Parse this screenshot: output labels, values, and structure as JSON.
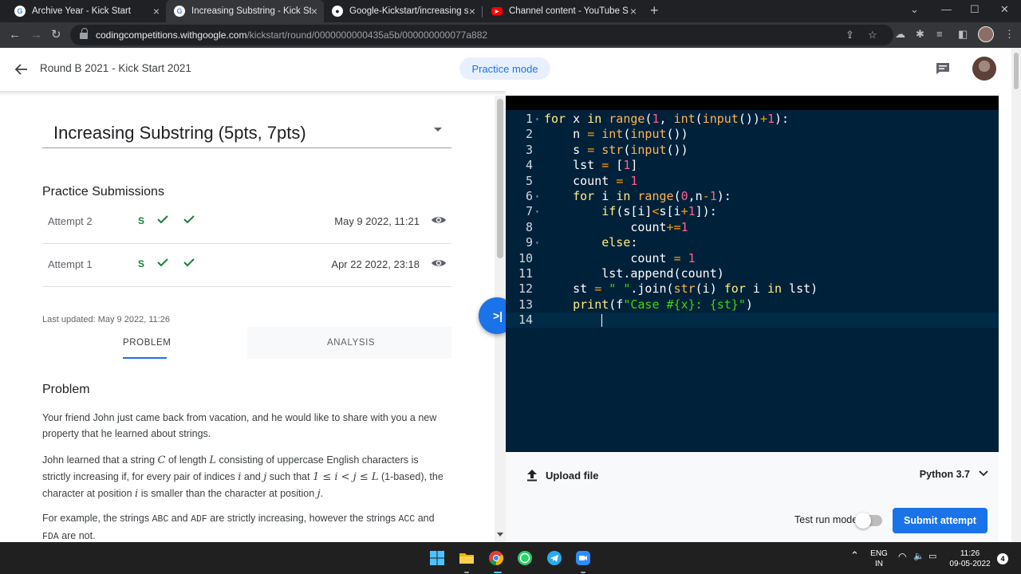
{
  "browser": {
    "tabs": [
      {
        "title": "Archive Year - Kick Start",
        "icon": "google-icon"
      },
      {
        "title": "Increasing Substring - Kick Start",
        "icon": "google-icon"
      },
      {
        "title": "Google-Kickstart/increasing subs",
        "icon": "github-icon"
      },
      {
        "title": "Channel content - YouTube Studi",
        "icon": "youtube-icon"
      }
    ],
    "url_host": "codingcompetitions.withgoogle.com",
    "url_path": "/kickstart/round/0000000000435a5b/000000000077a882"
  },
  "header": {
    "round_title": "Round B 2021 - Kick Start 2021",
    "practice_mode": "Practice mode"
  },
  "problem": {
    "title": "Increasing Substring (5pts, 7pts)",
    "submissions_title": "Practice Submissions",
    "attempts": [
      {
        "label": "Attempt 2",
        "status": "S",
        "date": "May 9 2022, 11:21"
      },
      {
        "label": "Attempt 1",
        "status": "S",
        "date": "Apr 22 2022, 23:18"
      }
    ],
    "last_updated": "Last updated: May 9 2022, 11:26",
    "tab_problem": "PROBLEM",
    "tab_analysis": "ANALYSIS",
    "heading": "Problem",
    "para1": "Your friend John just came back from vacation, and he would like to share with you a new property that he learned about strings.",
    "para2": {
      "t1": "John learned that a string ",
      "v1": "C",
      "t2": " of length ",
      "v2": "L",
      "t3": " consisting of uppercase English characters is strictly increasing if, for every pair of indices ",
      "v3": "i",
      "t4": " and ",
      "v4": "j",
      "t5": " such that ",
      "v5": "1 ≤ i < j ≤ L",
      "t6": " (1-based), the character at position ",
      "v6": "i",
      "t7": " is smaller than the character at position ",
      "v7": "j",
      "t8": "."
    },
    "para3": {
      "t1": "For example, the strings ",
      "c1": "ABC",
      "t2": " and ",
      "c2": "ADF",
      "t3": " are strictly increasing, however the strings ",
      "c3": "ACC",
      "t4": " and ",
      "c4": "FDA",
      "t5": " are not."
    }
  },
  "editor": {
    "line_numbers": [
      "1",
      "2",
      "3",
      "4",
      "5",
      "6",
      "7",
      "8",
      "9",
      "10",
      "11",
      "12",
      "13",
      "14"
    ],
    "upload_label": "Upload file",
    "language": "Python 3.7",
    "test_run_label": "Test run mode",
    "submit_label": "Submit attempt"
  },
  "system": {
    "lang_top": "ENG",
    "lang_bottom": "IN",
    "time": "11:26",
    "date": "09-05-2022",
    "notifications": "4"
  },
  "colors": {
    "accent": "#1a73e8",
    "editor_bg": "#00213a",
    "success": "#188038"
  }
}
